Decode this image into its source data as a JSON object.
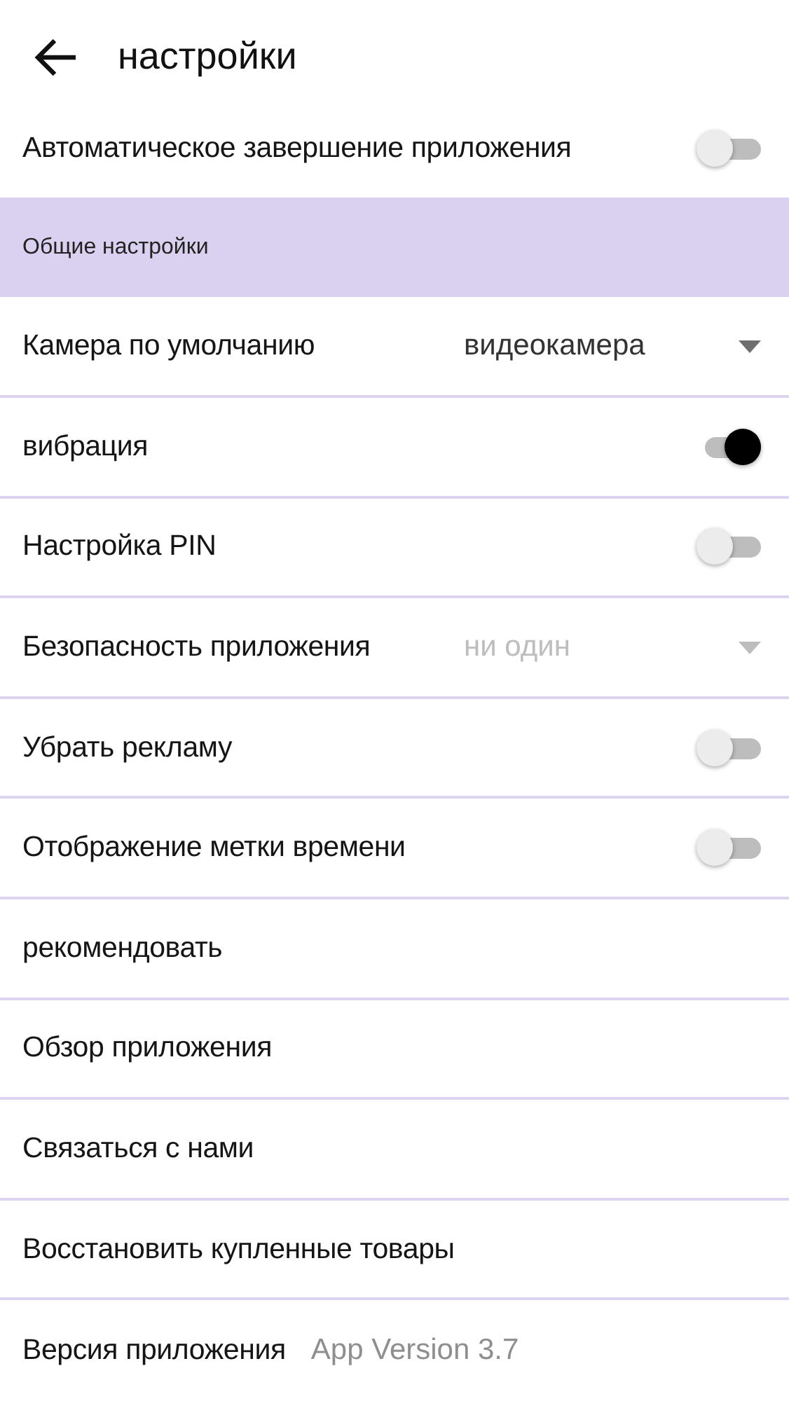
{
  "header": {
    "title": "настройки"
  },
  "top_items": [
    {
      "kind": "toggle",
      "label": "Автоматическое завершение приложения",
      "on": false
    }
  ],
  "section": {
    "title": "Общие настройки"
  },
  "items": [
    {
      "kind": "dropdown",
      "label": "Камера по умолчанию",
      "value": "видеокамера",
      "disabled": false
    },
    {
      "kind": "toggle",
      "label": "вибрация",
      "on": true
    },
    {
      "kind": "toggle",
      "label": "Настройка PIN",
      "on": false
    },
    {
      "kind": "dropdown",
      "label": "Безопасность приложения",
      "value": "ни один",
      "disabled": true
    },
    {
      "kind": "toggle",
      "label": "Убрать рекламу",
      "on": false
    },
    {
      "kind": "toggle",
      "label": "Отображение метки времени",
      "on": false
    },
    {
      "kind": "link",
      "label": "рекомендовать"
    },
    {
      "kind": "link",
      "label": "Обзор приложения"
    },
    {
      "kind": "link",
      "label": "Связаться с нами"
    },
    {
      "kind": "link",
      "label": "Восстановить купленные товары"
    },
    {
      "kind": "version",
      "label": "Версия приложения",
      "value": "App Version 3.7"
    }
  ]
}
